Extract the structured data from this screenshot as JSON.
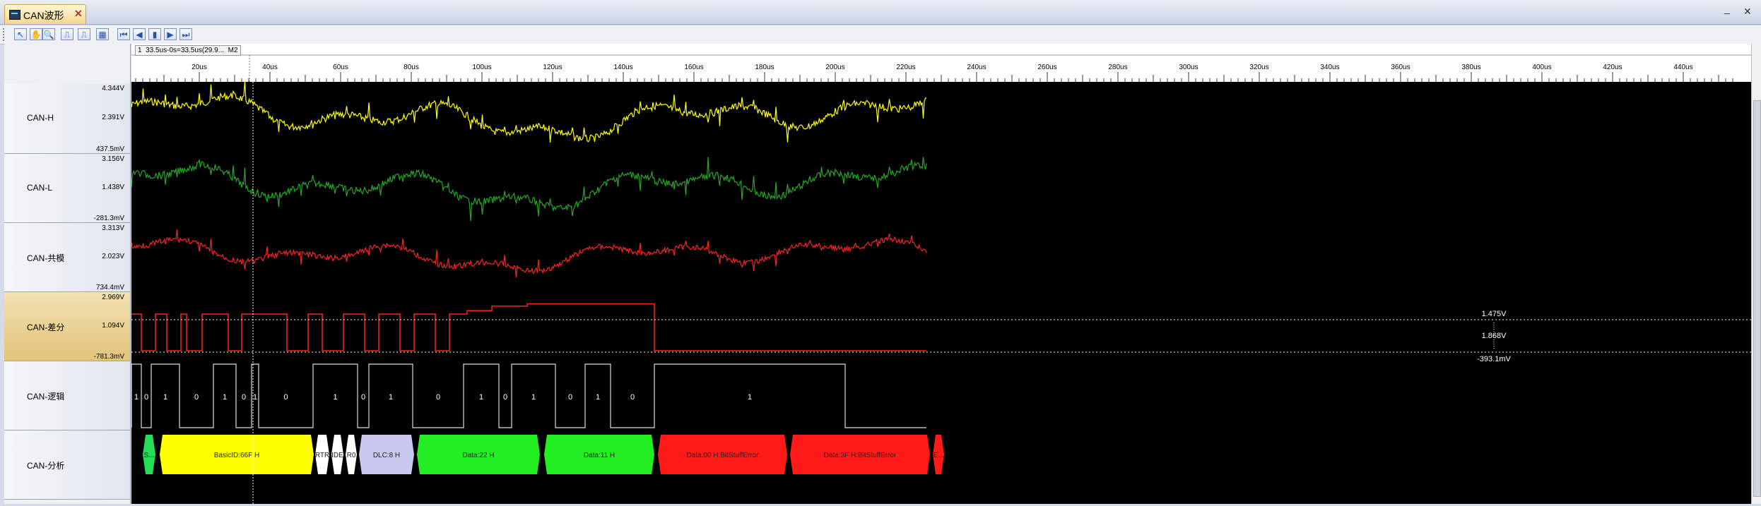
{
  "window": {
    "tab_title": "CAN波形",
    "tab_close": "✕",
    "btn_minimize": "_",
    "btn_close": "✕"
  },
  "toolbar": {
    "tools": [
      {
        "name": "pointer-tool",
        "glyph": "↖"
      },
      {
        "name": "hand-tool",
        "glyph": "✋"
      },
      {
        "name": "zoom-tool",
        "glyph": "🔍"
      },
      {
        "name": "edge-rise-tool",
        "glyph": "⎍"
      },
      {
        "name": "edge-fall-tool",
        "glyph": "⎍"
      },
      {
        "name": "grid-tool",
        "glyph": "▦"
      },
      {
        "name": "first-tool",
        "glyph": "⏮"
      },
      {
        "name": "prev-tool",
        "glyph": "◀"
      },
      {
        "name": "cursor-tool",
        "glyph": "▮"
      },
      {
        "name": "next-tool",
        "glyph": "▶"
      },
      {
        "name": "last-tool",
        "glyph": "⏭"
      }
    ]
  },
  "ruler": {
    "cursor_marker": "1",
    "cursor_readout": "33.5us-0s=33.5us(29.9...",
    "marker_m2": "M2",
    "unit": "us",
    "ticks": [
      "20us",
      "40us",
      "60us",
      "80us",
      "100us",
      "120us",
      "140us",
      "160us",
      "180us",
      "200us",
      "220us",
      "240us",
      "260us",
      "280us",
      "300us",
      "320us",
      "340us",
      "360us",
      "380us",
      "400us",
      "420us",
      "440us"
    ]
  },
  "channels": [
    {
      "name": "CAN-H",
      "max": "4.344V",
      "mid": "2.391V",
      "min": "437.5mV",
      "color": "#ffff00"
    },
    {
      "name": "CAN-L",
      "max": "3.156V",
      "mid": "1.438V",
      "min": "-281.3mV",
      "color": "#22a822"
    },
    {
      "name": "CAN-共模",
      "max": "3.313V",
      "mid": "2.023V",
      "min": "734.4mV",
      "color": "#ff2020"
    },
    {
      "name": "CAN-差分",
      "max": "2.969V",
      "mid": "1.094V",
      "min": "-781.3mV",
      "color": "#ff2020"
    },
    {
      "name": "CAN-逻辑",
      "max": "",
      "mid": "",
      "min": "",
      "color": "#ffffff"
    },
    {
      "name": "CAN-分析",
      "max": "",
      "mid": "",
      "min": "",
      "color": "#ffffff"
    }
  ],
  "measure": {
    "upper": "1.475V",
    "delta": "1.868V",
    "lower": "-393.1mV"
  },
  "logic_bits": [
    "1",
    "0",
    "1",
    "0",
    "1",
    "0",
    "1",
    "0",
    "1",
    "0",
    "1",
    "0",
    "1",
    "0",
    "1",
    "0",
    "1",
    "0",
    "1"
  ],
  "frames": [
    {
      "label": "S...",
      "color": "#22dd55"
    },
    {
      "label": "BasicID:66F H",
      "color": "#ffff00"
    },
    {
      "label": "RTR",
      "color": "#ffffff"
    },
    {
      "label": "IDE",
      "color": "#ffffff"
    },
    {
      "label": "R0",
      "color": "#ffffff"
    },
    {
      "label": "DLC:8 H",
      "color": "#c8c8f0"
    },
    {
      "label": "Data:22 H",
      "color": "#22ee22"
    },
    {
      "label": "Data:11 H",
      "color": "#22ee22"
    },
    {
      "label": "Data:00 H:BitStuffError",
      "color": "#ff1a1a"
    },
    {
      "label": "Data:3F H:BitStuffError",
      "color": "#ff1a1a"
    },
    {
      "label": "E...",
      "color": "#ff1a1a"
    }
  ],
  "colors": {
    "background": "#000000",
    "cursor": "#ffffff",
    "measure_line": "#ffffff"
  }
}
